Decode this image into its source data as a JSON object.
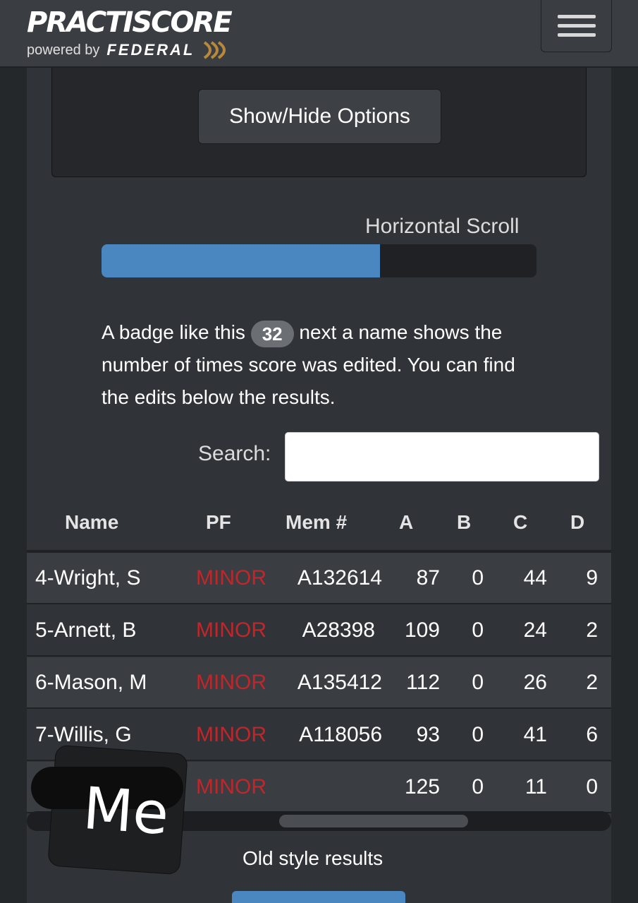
{
  "header": {
    "logo_main": "PRACTISCORE",
    "logo_powered": "powered by",
    "logo_brand": "FEDERAL",
    "brand_color": "#4a87c0",
    "menu_icon": "hamburger-icon"
  },
  "options": {
    "button_label": "Show/Hide Options"
  },
  "hscroll": {
    "label": "Horizontal Scroll",
    "progress_fraction": 0.64
  },
  "badge_note": {
    "before": "A badge like this",
    "badge": "32",
    "after": "next a name shows the number of times score was edited. You can find the edits below the results."
  },
  "search": {
    "label": "Search:",
    "value": ""
  },
  "table": {
    "columns": [
      "Name",
      "PF",
      "Mem #",
      "A",
      "B",
      "C",
      "D"
    ],
    "rows": [
      {
        "name": "4-Wright, S",
        "pf": "MINOR",
        "mem": "A132614",
        "a": "87",
        "b": "0",
        "c": "44",
        "d": "9"
      },
      {
        "name": "5-Arnett, B",
        "pf": "MINOR",
        "mem": "A28398",
        "a": "109",
        "b": "0",
        "c": "24",
        "d": "2"
      },
      {
        "name": "6-Mason, M",
        "pf": "MINOR",
        "mem": "A135412",
        "a": "112",
        "b": "0",
        "c": "26",
        "d": "2"
      },
      {
        "name": "7-Willis, G",
        "pf": "MINOR",
        "mem": "A118056",
        "a": "93",
        "b": "0",
        "c": "41",
        "d": "6"
      },
      {
        "name": "",
        "pf": "MINOR",
        "mem": "",
        "a": "125",
        "b": "0",
        "c": "11",
        "d": "0"
      }
    ],
    "pf_color": "#c0262a"
  },
  "footer": {
    "old_style_label": "Old style results"
  },
  "annotation": {
    "text": "Me"
  }
}
